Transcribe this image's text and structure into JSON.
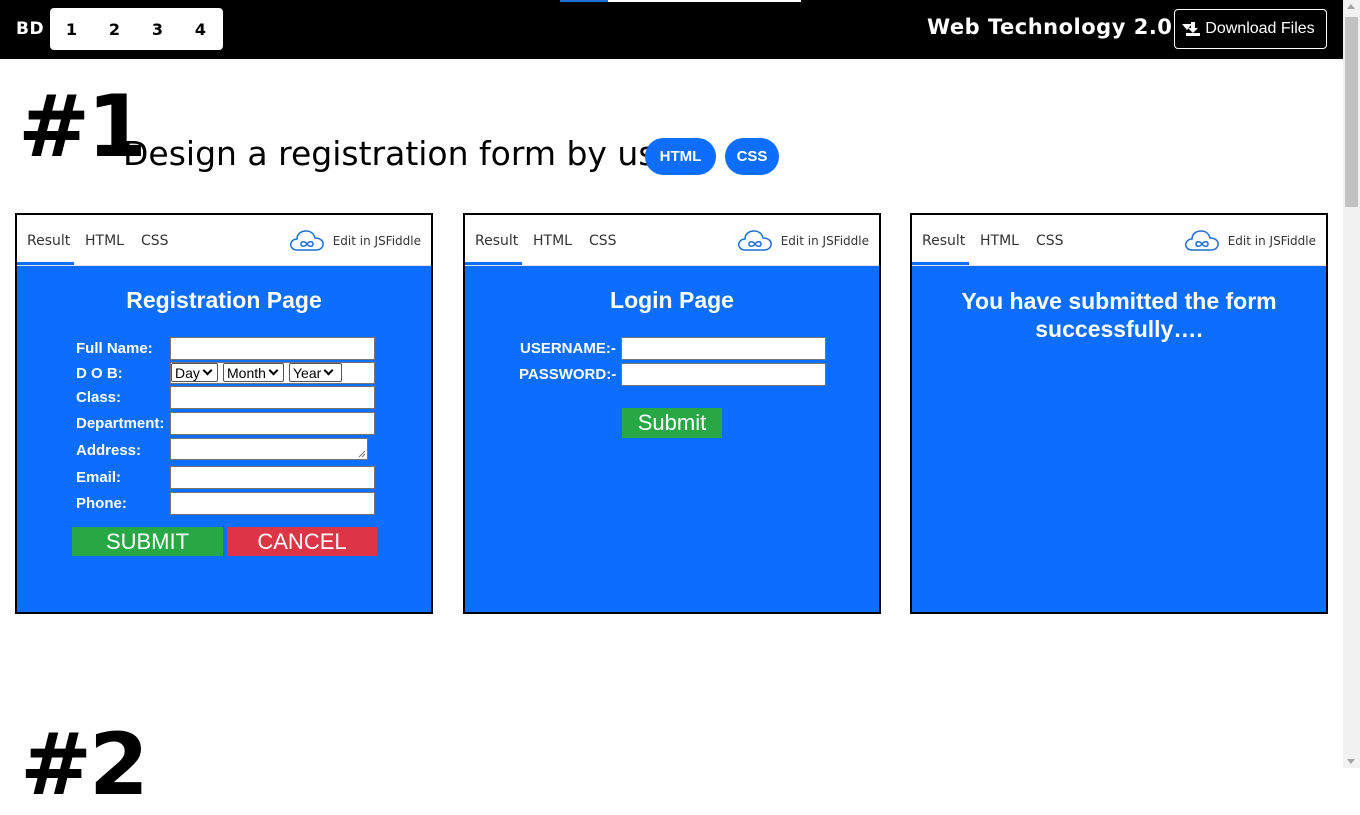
{
  "navbar": {
    "brand": "BD",
    "pages": [
      "1",
      "2",
      "3",
      "4"
    ],
    "title": "Web Technology 2.0",
    "download_label": "Download Files"
  },
  "section": {
    "number": "#1",
    "title": "Design a registration form by using",
    "tags": [
      "HTML",
      "CSS"
    ]
  },
  "fiddle_tabs": {
    "result": "Result",
    "html": "HTML",
    "css": "CSS",
    "edit": "Edit in JSFiddle"
  },
  "registration": {
    "title": "Registration Page",
    "labels": [
      "Full Name:",
      "D O B:",
      "Class:",
      "Department:",
      "Address:",
      "Email:",
      "Phone:"
    ],
    "dob_selects": [
      "Day",
      "Month",
      "Year"
    ],
    "submit": "SUBMIT",
    "cancel": "CANCEL"
  },
  "login": {
    "title": "Login Page",
    "username_label": "USERNAME:-",
    "password_label": "PASSWORD:-",
    "submit": "Submit"
  },
  "success": {
    "message": "You have submitted the form successfully…."
  },
  "next_section": {
    "number": "#2"
  },
  "colors": {
    "navbar": "#000000",
    "primary": "#0d6efd",
    "submit_green": "#28a745",
    "cancel_red": "#dc3545"
  }
}
